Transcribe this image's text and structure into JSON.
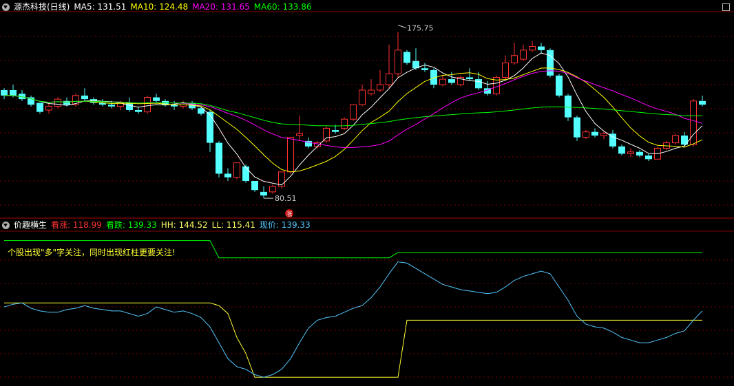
{
  "top_header": {
    "stock_name": "源杰科技(日线)",
    "ma5": "MA5: 131.51",
    "ma10": "MA10: 124.48",
    "ma20": "MA20: 131.65",
    "ma60": "MA60: 133.86"
  },
  "bottom_header": {
    "indicator_name": "价趣横生",
    "kanzhang": "看涨: 118.99",
    "kandie": "看跌: 139.33",
    "hh": "HH: 144.52",
    "ll": "LL: 115.41",
    "price": "现价: 139.33"
  },
  "annotation": "个股出现\"多\"字关注，同时出现红柱更要关注!",
  "colors": {
    "up": "#ff3232",
    "down": "#54ffff",
    "ma5": "#ffffff",
    "ma10": "#ffff00",
    "ma20": "#ff00ff",
    "ma60": "#00ff00",
    "grid": "#800000",
    "hh": "#00ff00",
    "ll": "#ffff33",
    "price": "#54c8ff"
  },
  "chart_data": {
    "type": "candlestick",
    "candles": [
      [
        140,
        141,
        137,
        135
      ],
      [
        140,
        143,
        137,
        136
      ],
      [
        138,
        140,
        135,
        134
      ],
      [
        136,
        137,
        132,
        131
      ],
      [
        133,
        133,
        128,
        127
      ],
      [
        129,
        133,
        131,
        127
      ],
      [
        131,
        136,
        135,
        130
      ],
      [
        134,
        136,
        132,
        131
      ],
      [
        132,
        138,
        137,
        131
      ],
      [
        137,
        141,
        135,
        134
      ],
      [
        135,
        136,
        133,
        132
      ],
      [
        133,
        135,
        132,
        131
      ],
      [
        132,
        134,
        131,
        130
      ],
      [
        131,
        134,
        133,
        129
      ],
      [
        133,
        136,
        129,
        128
      ],
      [
        129,
        131,
        128,
        127
      ],
      [
        128,
        137,
        136,
        127
      ],
      [
        136,
        138,
        134,
        133
      ],
      [
        134,
        135,
        132,
        131
      ],
      [
        132,
        134,
        131,
        129
      ],
      [
        131,
        134,
        133,
        130
      ],
      [
        133,
        134,
        130,
        129
      ],
      [
        130,
        131,
        127,
        126
      ],
      [
        128,
        129,
        111,
        106
      ],
      [
        111,
        112,
        94,
        92
      ],
      [
        94,
        97,
        92,
        90
      ],
      [
        92,
        100,
        100,
        91
      ],
      [
        98,
        99,
        90,
        89
      ],
      [
        90,
        90,
        85,
        84
      ],
      [
        84,
        87,
        82,
        80.51
      ],
      [
        84,
        88,
        87,
        83
      ],
      [
        87,
        95,
        95,
        86
      ],
      [
        95,
        114,
        114,
        94
      ],
      [
        115,
        126,
        116,
        112
      ],
      [
        112,
        114,
        109,
        108
      ],
      [
        109,
        112,
        111,
        108
      ],
      [
        112,
        120,
        119,
        111
      ],
      [
        118,
        121,
        117,
        116
      ],
      [
        119,
        125,
        124,
        118
      ],
      [
        124,
        132,
        132,
        123
      ],
      [
        132,
        143,
        140,
        131
      ],
      [
        138,
        146,
        140,
        137
      ],
      [
        140,
        151,
        143,
        139
      ],
      [
        143,
        165,
        149,
        141
      ],
      [
        149,
        172,
        162,
        147
      ],
      [
        161,
        162,
        155,
        154
      ],
      [
        156,
        163,
        152,
        151
      ],
      [
        152,
        155,
        151,
        150
      ],
      [
        151,
        152,
        143,
        141
      ],
      [
        143,
        148,
        146,
        142
      ],
      [
        146,
        150,
        144,
        143
      ],
      [
        143,
        148,
        147,
        142
      ],
      [
        147,
        152,
        146,
        145
      ],
      [
        146,
        150,
        141,
        140
      ],
      [
        141,
        145,
        138,
        137
      ],
      [
        138,
        148,
        147,
        137
      ],
      [
        147,
        159,
        155,
        146
      ],
      [
        155,
        166,
        159,
        154
      ],
      [
        157,
        165,
        162,
        156
      ],
      [
        162,
        167,
        164,
        161
      ],
      [
        164,
        166,
        162,
        160
      ],
      [
        162,
        163,
        148,
        147
      ],
      [
        148,
        149,
        137,
        136
      ],
      [
        137,
        138,
        125,
        123
      ],
      [
        125,
        126,
        114,
        112
      ],
      [
        114,
        118,
        117,
        113
      ],
      [
        117,
        119,
        115,
        114
      ],
      [
        115,
        117,
        116,
        113
      ],
      [
        116,
        118,
        109,
        108
      ],
      [
        109,
        110,
        105,
        104
      ],
      [
        105,
        108,
        106,
        103
      ],
      [
        106,
        107,
        104,
        103
      ],
      [
        104,
        105,
        102,
        101
      ],
      [
        102,
        109,
        108,
        102
      ],
      [
        108,
        112,
        111,
        107
      ],
      [
        111,
        116,
        115,
        110
      ],
      [
        115,
        117,
        110,
        109
      ],
      [
        110,
        135,
        134,
        109
      ],
      [
        134,
        137,
        132,
        131
      ]
    ],
    "ma_overlay_colors": [
      "#ffffff",
      "#ffff00",
      "#ff00ff",
      "#00ff00"
    ],
    "price_ylim": [
      76,
      182
    ],
    "annotations": {
      "high": {
        "label": "175.75",
        "index": 44,
        "value": 175.75
      },
      "low": {
        "label": "80.51",
        "index": 29,
        "value": 80.51
      },
      "low_marker": "涨"
    },
    "indicator": {
      "hh": [
        185,
        185,
        185,
        185,
        185,
        185,
        185,
        185,
        185,
        185,
        185,
        185,
        185,
        185,
        185,
        185,
        185,
        185,
        185,
        185,
        185,
        185,
        185,
        185,
        172,
        172,
        172,
        172,
        172,
        172,
        172,
        172,
        172,
        172,
        172,
        172,
        172,
        172,
        172,
        172,
        172,
        172,
        172,
        172,
        176,
        176,
        176,
        176,
        176,
        176,
        176,
        176,
        176,
        176,
        176,
        176,
        176,
        176,
        176,
        176,
        176,
        176,
        176,
        176,
        176,
        176,
        176,
        176,
        176,
        176,
        176,
        176,
        176,
        176,
        176,
        176,
        176,
        176,
        176
      ],
      "ll": [
        138,
        138,
        138,
        138,
        138,
        138,
        138,
        138,
        138,
        138,
        138,
        138,
        138,
        138,
        138,
        138,
        138,
        138,
        138,
        138,
        138,
        138,
        138,
        138,
        136,
        130,
        112,
        100,
        82,
        82,
        82,
        82,
        82,
        82,
        82,
        82,
        82,
        82,
        82,
        82,
        82,
        82,
        82,
        82,
        82,
        125,
        125,
        125,
        125,
        125,
        125,
        125,
        125,
        125,
        125,
        125,
        125,
        125,
        125,
        125,
        125,
        125,
        125,
        125,
        125,
        125,
        125,
        125,
        125,
        125,
        125,
        125,
        125,
        125,
        125,
        125,
        125,
        125,
        125
      ],
      "price": [
        135,
        137,
        138,
        134,
        132,
        131,
        131,
        133,
        134,
        136,
        134,
        133,
        132,
        132,
        130,
        128,
        130,
        135,
        133,
        131,
        132,
        130,
        127,
        120,
        108,
        96,
        90,
        88,
        84,
        82,
        84,
        88,
        96,
        108,
        119,
        125,
        127,
        128,
        131,
        134,
        136,
        142,
        150,
        160,
        169,
        168,
        164,
        160,
        156,
        152,
        150,
        148,
        147,
        146,
        145,
        146,
        150,
        155,
        158,
        160,
        162,
        160,
        150,
        140,
        128,
        122,
        120,
        119,
        116,
        112,
        110,
        108,
        108,
        110,
        112,
        115,
        117,
        125,
        132
      ],
      "duo_markers": [],
      "red_bars": [],
      "diamonds": []
    }
  }
}
